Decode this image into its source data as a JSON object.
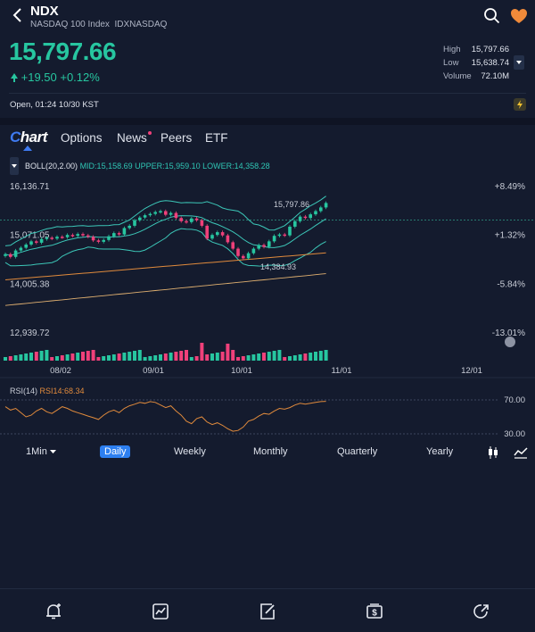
{
  "header": {
    "ticker": "NDX",
    "name": "NASDAQ 100 Index",
    "exchange_code": "IDXNASDAQ",
    "price": "15,797.66",
    "change": "+19.50 +0.12%",
    "stats": [
      {
        "label": "High",
        "value": "15,797.66"
      },
      {
        "label": "Low",
        "value": "15,638.74"
      },
      {
        "label": "Volume",
        "value": "72.10M"
      }
    ],
    "market_status": "Open, 01:24 10/30 KST"
  },
  "tabs": {
    "chart_c": "C",
    "chart_rest": "hart",
    "items": [
      "Options",
      "News",
      "Peers",
      "ETF"
    ]
  },
  "indicator": {
    "boll_name": "BOLL(20,2.00)",
    "boll_values": "MID:15,158.69 UPPER:15,959.10 LOWER:14,358.28",
    "rsi_name": "RSI(14)",
    "rsi_value": "RSI14:68.34"
  },
  "chart_data": {
    "type": "candlestick",
    "y_left_ticks": [
      "16,136.71",
      "15,071.05",
      "14,005.38",
      "12,939.72"
    ],
    "y_right_ticks": [
      "+8.49%",
      "+1.32%",
      "-5.84%",
      "-13.01%"
    ],
    "x_ticks": [
      "08/02",
      "09/01",
      "10/01",
      "11/01",
      "12/01"
    ],
    "annotations": {
      "last_high": "15,797.86",
      "period_low": "14,384.93"
    },
    "closes": [
      14680,
      14620,
      14760,
      14820,
      14890,
      14960,
      14930,
      15010,
      15040,
      15020,
      15060,
      15050,
      15100,
      15080,
      15120,
      15090,
      15060,
      14980,
      14950,
      14990,
      15070,
      15140,
      15110,
      15250,
      15300,
      15420,
      15480,
      15530,
      15560,
      15600,
      15620,
      15540,
      15580,
      15470,
      15400,
      15380,
      15460,
      15420,
      15300,
      15020,
      15100,
      15160,
      15090,
      14940,
      14800,
      14640,
      14590,
      14700,
      14800,
      14880,
      14840,
      14960,
      15080,
      15110,
      15090,
      15280,
      15400,
      15500,
      15470,
      15550,
      15620,
      15700,
      15797.66
    ],
    "rsi": [
      62,
      58,
      60,
      55,
      50,
      52,
      57,
      60,
      56,
      54,
      58,
      62,
      60,
      57,
      55,
      53,
      51,
      49,
      47,
      52,
      56,
      58,
      55,
      60,
      63,
      65,
      67,
      66,
      68,
      67,
      64,
      61,
      63,
      57,
      52,
      45,
      42,
      48,
      50,
      44,
      41,
      43,
      40,
      36,
      33,
      34,
      38,
      45,
      47,
      51,
      54,
      53,
      57,
      60,
      59,
      61,
      64,
      66,
      65,
      66,
      67,
      68,
      68.34
    ],
    "rsi_levels": [
      "70.00",
      "30.00"
    ]
  },
  "intervals": [
    "1Min",
    "Daily",
    "Weekly",
    "Monthly",
    "Quarterly",
    "Yearly"
  ],
  "colors": {
    "up": "#27c6a0",
    "down": "#f0407a",
    "background": "#141b2e",
    "accent": "#3f7bf2"
  }
}
